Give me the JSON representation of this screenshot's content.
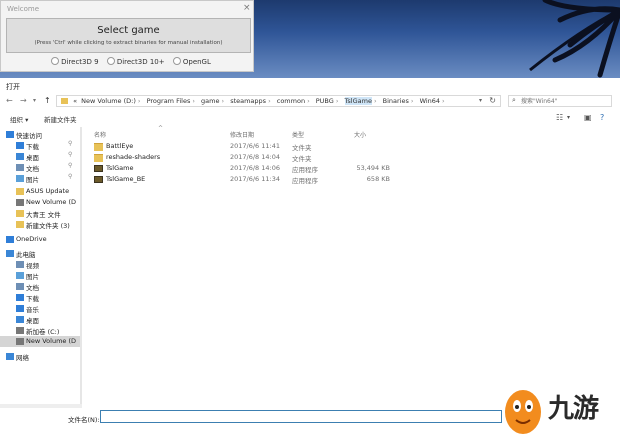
{
  "welcome": {
    "title": "Welcome",
    "close": "×",
    "select_label": "Select game",
    "select_hint": "(Press 'Ctrl' while clicking to extract binaries for manual installation)",
    "apis": [
      "Direct3D 9",
      "Direct3D 10+",
      "OpenGL"
    ]
  },
  "dialog": {
    "title": "打开",
    "breadcrumbs": [
      "«",
      "New Volume (D:)",
      "Program Files",
      "game",
      "steamapps",
      "common",
      "PUBG",
      "TslGame",
      "Binaries",
      "Win64"
    ],
    "search_placeholder": "搜索\"Win64\"",
    "toolbar": {
      "organize": "组织 ▾",
      "new_folder": "新建文件夹"
    },
    "nav": [
      {
        "label": "快速访问",
        "icon": "star-icon",
        "pin": false
      },
      {
        "label": "下载",
        "icon": "download-icon",
        "pin": true
      },
      {
        "label": "桌面",
        "icon": "desktop-icon",
        "pin": true
      },
      {
        "label": "文档",
        "icon": "document-icon",
        "pin": true
      },
      {
        "label": "图片",
        "icon": "picture-icon",
        "pin": true
      },
      {
        "label": "ASUS Update",
        "icon": "folder-icon",
        "pin": false
      },
      {
        "label": "New Volume (D",
        "icon": "drive-icon",
        "pin": false
      },
      {
        "label": "大青王 文件",
        "icon": "folder-icon",
        "pin": false
      },
      {
        "label": "新建文件夹 (3)",
        "icon": "folder-icon",
        "pin": false
      },
      {
        "label": "OneDrive",
        "icon": "cloud-icon",
        "pin": false
      },
      {
        "label": "此电脑",
        "icon": "computer-icon",
        "pin": false
      },
      {
        "label": "视频",
        "icon": "video-icon",
        "pin": false
      },
      {
        "label": "图片",
        "icon": "picture-icon",
        "pin": false
      },
      {
        "label": "文档",
        "icon": "document-icon",
        "pin": false
      },
      {
        "label": "下载",
        "icon": "download-icon",
        "pin": false
      },
      {
        "label": "音乐",
        "icon": "music-icon",
        "pin": false
      },
      {
        "label": "桌面",
        "icon": "desktop-icon",
        "pin": false
      },
      {
        "label": "新加卷 (C:)",
        "icon": "drive-icon",
        "pin": false
      },
      {
        "label": "New Volume (D",
        "icon": "drive-icon",
        "pin": false,
        "selected": true
      },
      {
        "label": "网络",
        "icon": "network-icon",
        "pin": false
      }
    ],
    "columns": {
      "name": "名称",
      "date": "修改日期",
      "type": "类型",
      "size": "大小"
    },
    "files": [
      {
        "name": "BattlEye",
        "date": "2017/6/6 11:41",
        "type": "文件夹",
        "size": "",
        "icon": "folder-icon"
      },
      {
        "name": "reshade-shaders",
        "date": "2017/6/8 14:04",
        "type": "文件夹",
        "size": "",
        "icon": "folder-icon"
      },
      {
        "name": "TslGame",
        "date": "2017/6/8 14:06",
        "type": "应用程序",
        "size": "53,494 KB",
        "icon": "app-icon"
      },
      {
        "name": "TslGame_BE",
        "date": "2017/6/6 11:34",
        "type": "应用程序",
        "size": "658 KB",
        "icon": "app-icon"
      }
    ],
    "filename_label": "文件名(N):",
    "filename_value": ""
  },
  "watermark": {
    "text": "九游"
  }
}
